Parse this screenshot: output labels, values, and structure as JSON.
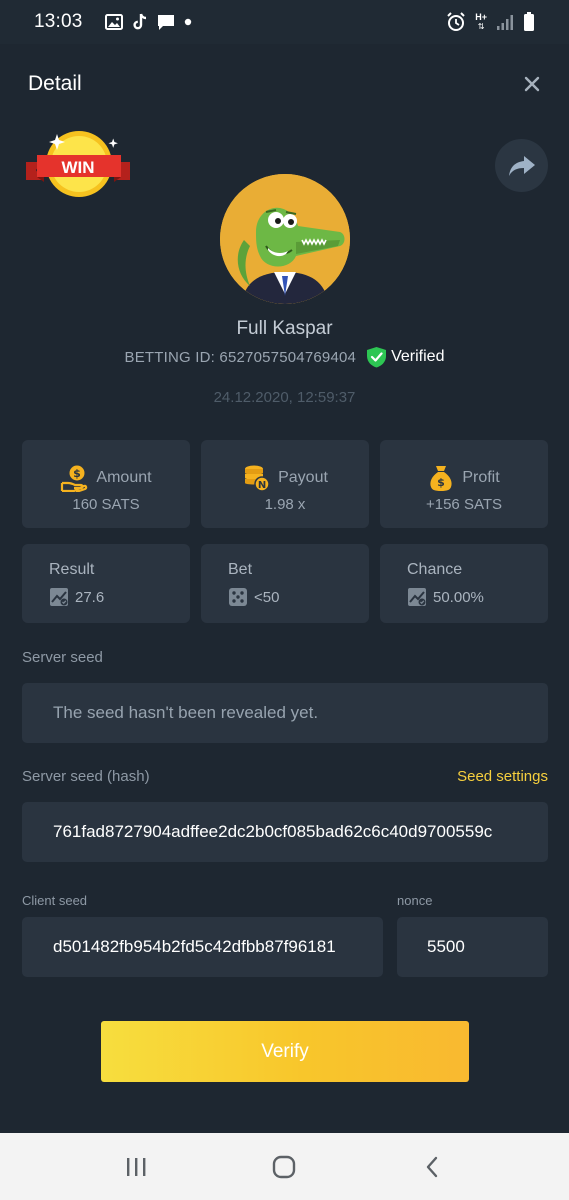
{
  "status_bar": {
    "time": "13:03",
    "icons_left": [
      "gallery-icon",
      "tiktok-icon",
      "chat-icon",
      "dot-icon"
    ],
    "icons_right": [
      "alarm-icon",
      "network-icon",
      "signal-icon",
      "battery-icon"
    ],
    "network_label": "H+"
  },
  "header": {
    "title": "Detail"
  },
  "win_badge": {
    "label": "WIN"
  },
  "user": {
    "name": "Full Kaspar",
    "betting_id": "BETTING ID: 6527057504769404",
    "verified_label": "Verified",
    "datetime": "24.12.2020, 12:59:37"
  },
  "stats_top": [
    {
      "label": "Amount",
      "value": "160 SATS",
      "icon": "coin-hand-icon"
    },
    {
      "label": "Payout",
      "value": "1.98 x",
      "icon": "coin-stack-icon"
    },
    {
      "label": "Profit",
      "value": "+156 SATS",
      "icon": "money-bag-icon"
    }
  ],
  "stats_bottom": [
    {
      "label": "Result",
      "value": "27.6",
      "icon": "result-chart-icon"
    },
    {
      "label": "Bet",
      "value": "<50",
      "icon": "dice-icon"
    },
    {
      "label": "Chance",
      "value": "50.00%",
      "icon": "chance-chart-icon"
    }
  ],
  "server_seed": {
    "label": "Server seed",
    "value": "The seed hasn't been revealed yet."
  },
  "server_seed_hash": {
    "label": "Server seed (hash)",
    "settings_link": "Seed settings",
    "value": "761fad8727904adffee2dc2b0cf085bad62c6c40d9700559c"
  },
  "client_seed": {
    "label": "Client seed",
    "value": "d501482fb954b2fd5c42dfbb87f96181"
  },
  "nonce": {
    "label": "nonce",
    "value": "5500"
  },
  "verify_button": {
    "label": "Verify"
  },
  "colors": {
    "background": "#1e2731",
    "card": "#2a3440",
    "accent_yellow": "#f6cf3e",
    "verified_green": "#2dc653"
  }
}
